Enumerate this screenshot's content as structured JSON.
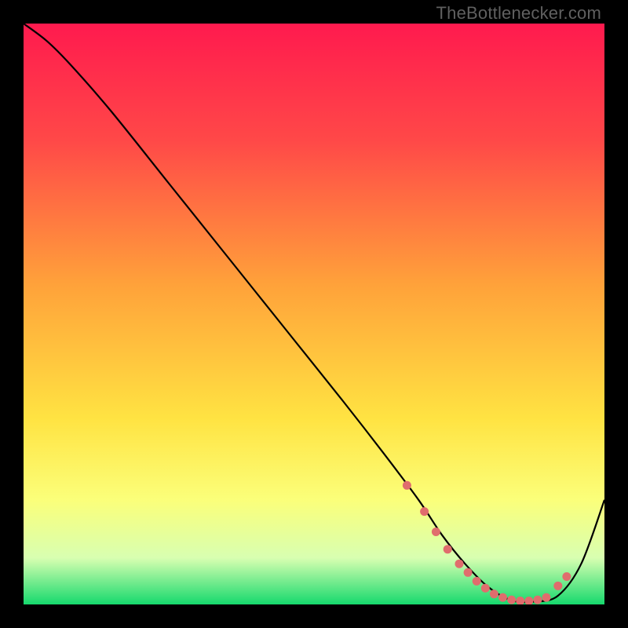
{
  "watermark": "TheBottlenecker.com",
  "chart_data": {
    "type": "line",
    "title": "",
    "xlabel": "",
    "ylabel": "",
    "xlim": [
      0,
      100
    ],
    "ylim": [
      0,
      100
    ],
    "gradient_stops": [
      {
        "offset": 0,
        "color": "#ff1a4e"
      },
      {
        "offset": 20,
        "color": "#ff4848"
      },
      {
        "offset": 45,
        "color": "#ffa23a"
      },
      {
        "offset": 68,
        "color": "#ffe342"
      },
      {
        "offset": 82,
        "color": "#fbff7a"
      },
      {
        "offset": 92,
        "color": "#d8ffb1"
      },
      {
        "offset": 100,
        "color": "#16d96d"
      }
    ],
    "series": [
      {
        "name": "curve",
        "x": [
          0,
          4,
          8,
          15,
          25,
          35,
          45,
          55,
          62,
          68,
          72,
          76,
          80,
          84,
          88,
          92,
          96,
          100
        ],
        "y": [
          100,
          97,
          93,
          85,
          72.5,
          60,
          47.5,
          35,
          26,
          18,
          12,
          7,
          3,
          0.7,
          0.5,
          1.5,
          7,
          18
        ]
      }
    ],
    "marker_points": {
      "name": "bottleneck-points",
      "color": "#e06d6d",
      "x": [
        66,
        69,
        71,
        73,
        75,
        76.5,
        78,
        79.5,
        81,
        82.5,
        84,
        85.5,
        87,
        88.5,
        90,
        92,
        93.5
      ],
      "y": [
        20.5,
        16,
        12.5,
        9.5,
        7,
        5.5,
        4,
        2.8,
        1.8,
        1.2,
        0.8,
        0.6,
        0.6,
        0.8,
        1.2,
        3.2,
        4.8
      ]
    }
  }
}
